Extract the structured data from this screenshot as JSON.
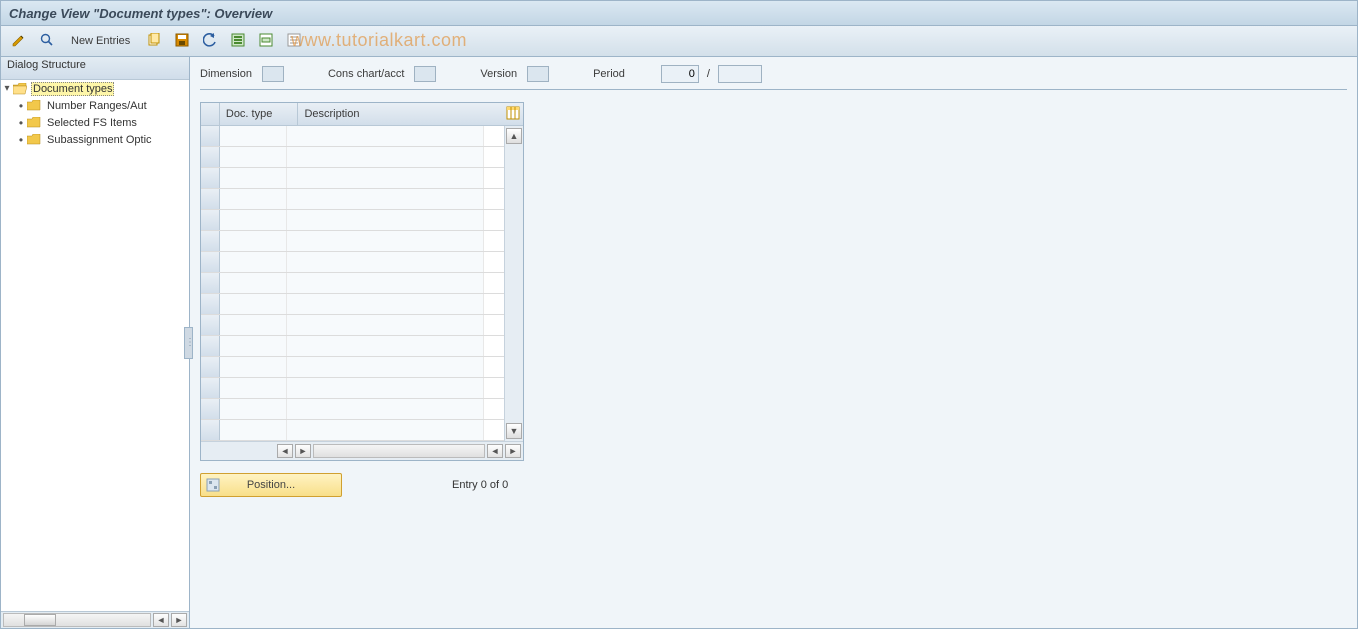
{
  "title": "Change View \"Document types\": Overview",
  "watermark": "www.tutorialkart.com",
  "toolbar": {
    "new_entries_label": "New Entries",
    "icons": {
      "toggle": "toggle-change-icon",
      "details": "details-icon",
      "copy": "copy-icon",
      "save": "save-icon",
      "undo": "undo-icon",
      "select_all": "select-all-icon",
      "deselect_all": "deselect-all-icon",
      "table_settings": "table-settings-icon"
    }
  },
  "sidebar": {
    "header": "Dialog Structure",
    "nodes": [
      {
        "label": "Document types",
        "open": true,
        "selected": true,
        "level": 0
      },
      {
        "label": "Number Ranges/Aut",
        "open": false,
        "selected": false,
        "level": 1
      },
      {
        "label": "Selected FS Items",
        "open": false,
        "selected": false,
        "level": 1
      },
      {
        "label": "Subassignment Optic",
        "open": false,
        "selected": false,
        "level": 1
      }
    ]
  },
  "filters": {
    "dimension_label": "Dimension",
    "cons_chart_label": "Cons chart/acct",
    "version_label": "Version",
    "period_label": "Period",
    "period_value": "0",
    "separator": "/"
  },
  "grid": {
    "col_doc_type": "Doc. type",
    "col_description": "Description",
    "row_count": 15
  },
  "footer": {
    "position_label": "Position...",
    "entry_text": "Entry 0 of 0"
  }
}
